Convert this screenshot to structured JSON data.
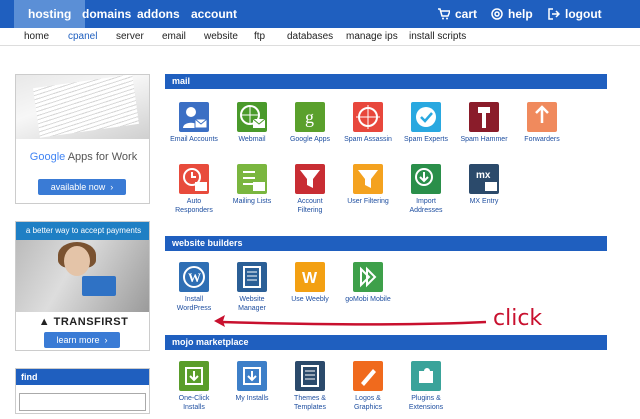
{
  "topnav": {
    "hosting": "hosting",
    "domains": "domains",
    "addons": "addons",
    "account": "account",
    "cart": "cart",
    "help": "help",
    "logout": "logout"
  },
  "subnav": [
    "home",
    "cpanel",
    "server",
    "email",
    "website",
    "ftp",
    "databases",
    "manage ips",
    "install scripts"
  ],
  "promo_google": {
    "brand": "Google",
    "suffix": "Apps for Work",
    "button": "available now"
  },
  "promo_transfirst": {
    "headline": "a better way to accept payments",
    "logo": "TRANSFIRST",
    "button": "learn more"
  },
  "find": {
    "title": "find",
    "value": ""
  },
  "sections": {
    "mail": "mail",
    "website_builders": "website builders",
    "mojo": "mojo marketplace"
  },
  "mail_row1": [
    "Email Accounts",
    "Webmail",
    "Google Apps",
    "Spam Assassin",
    "Spam Experts",
    "Spam Hammer",
    "Forwarders"
  ],
  "mail_row2": [
    [
      "Auto",
      "Responders"
    ],
    [
      "Mailing Lists",
      ""
    ],
    [
      "Account",
      "Filtering"
    ],
    [
      "User Filtering",
      ""
    ],
    [
      "Import",
      "Addresses"
    ],
    [
      "MX Entry",
      ""
    ]
  ],
  "builders": [
    [
      "Install",
      "WordPress"
    ],
    [
      "Website",
      "Manager"
    ],
    [
      "Use Weebly",
      ""
    ],
    [
      "goMobi Mobile",
      ""
    ]
  ],
  "mojo": [
    [
      "One-Click",
      "Installs"
    ],
    [
      "My Installs",
      ""
    ],
    [
      "Themes &",
      "Templates"
    ],
    [
      "Logos &",
      "Graphics"
    ],
    [
      "Plugins &",
      "Extensions"
    ]
  ],
  "annotation": "click",
  "colors": {
    "nav": "#1f5fbf",
    "accent": "#c8102e"
  }
}
